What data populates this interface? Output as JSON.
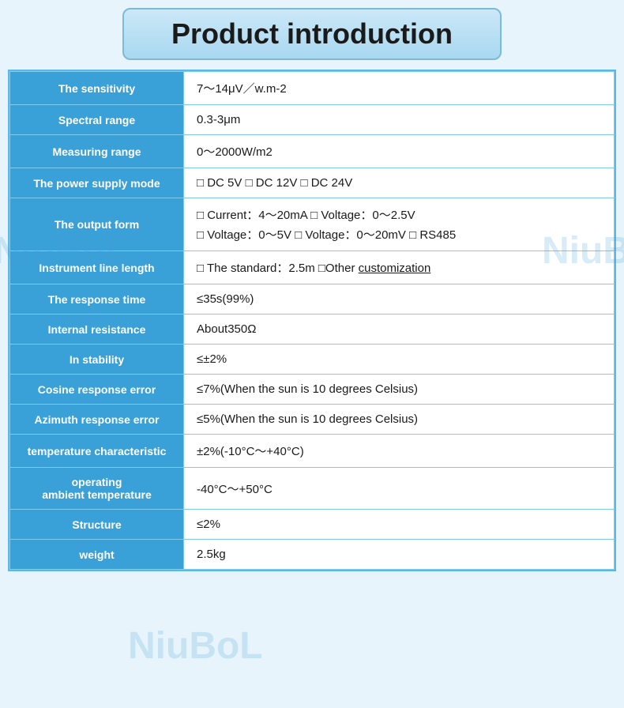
{
  "title": "Product introduction",
  "rows": [
    {
      "label": "The sensitivity",
      "value_type": "text",
      "value": "7～14μV／w.m-2"
    },
    {
      "label": "Spectral range",
      "value_type": "text",
      "value": "0.3-3μm"
    },
    {
      "label": "Measuring range",
      "value_type": "text",
      "value": "0～2000W/m2"
    },
    {
      "label": "The power supply mode",
      "value_type": "checkboxes",
      "value": "□ DC 5V  □ DC 12V  □ DC 24V"
    },
    {
      "label": "The output form",
      "value_type": "multiline",
      "lines": [
        "□ Current：4～20mA □ Voltage：0～2.5V",
        "□ Voltage：0～5V □ Voltage：0～20mV □ RS485"
      ]
    },
    {
      "label": "Instrument line length",
      "value_type": "underline",
      "value": "□ The standard：2.5m □Other ",
      "underline": "customization"
    },
    {
      "label": "The response time",
      "value_type": "text",
      "value": "≤35s(99%)"
    },
    {
      "label": "Internal resistance",
      "value_type": "text",
      "value": "About350Ω"
    },
    {
      "label": "In stability",
      "value_type": "text",
      "value": "≤±2%"
    },
    {
      "label": "Cosine response error",
      "value_type": "text",
      "value": "≤7%(When the sun is 10 degrees Celsius)"
    },
    {
      "label": "Azimuth response error",
      "value_type": "text",
      "value": "≤5%(When the sun is 10 degrees Celsius)"
    },
    {
      "label": "temperature characteristic",
      "value_type": "text",
      "value": "±2%(-10°C～+40°C)"
    },
    {
      "label": "operating\nambient temperature",
      "value_type": "text",
      "value": "-40°C～+50°C"
    },
    {
      "label": "Structure",
      "value_type": "text",
      "value": "≤2%"
    },
    {
      "label": "weight",
      "value_type": "text",
      "value": "2.5kg"
    }
  ],
  "watermarks": [
    "NiuBoL",
    "NiuB",
    "NiuBoL"
  ]
}
